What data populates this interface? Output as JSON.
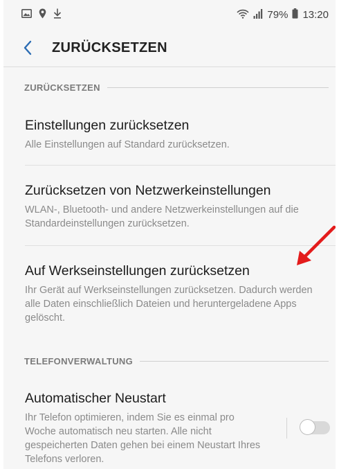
{
  "status_bar": {
    "battery_percent": "79%",
    "time": "13:20",
    "icons_left": [
      "image-icon",
      "location-icon",
      "download-icon"
    ],
    "icons_right": [
      "wifi-icon",
      "signal-icon",
      "battery-icon"
    ]
  },
  "header": {
    "back_icon": "chevron-left-icon",
    "title": "ZURÜCKSETZEN"
  },
  "sections": [
    {
      "title": "ZURÜCKSETZEN",
      "items": [
        {
          "title": "Einstellungen zurücksetzen",
          "subtitle": "Alle Einstellungen auf Standard zurücksetzen."
        },
        {
          "title": "Zurücksetzen von Netzwerkeinstellungen",
          "subtitle": "WLAN-, Bluetooth- und andere Netzwerkeinstellungen auf die Standardeinstellungen zurücksetzen."
        },
        {
          "title": "Auf Werkseinstellungen zurücksetzen",
          "subtitle": "Ihr Gerät auf Werkseinstellungen zurücksetzen. Dadurch werden alle Daten einschließlich Dateien und heruntergeladene Apps gelöscht."
        }
      ]
    },
    {
      "title": "TELEFONVERWALTUNG",
      "items": [
        {
          "title": "Automatischer Neustart",
          "subtitle": "Ihr Telefon optimieren, indem Sie es einmal pro Woche automatisch neu starten. Alle nicht gespeicherten Daten gehen bei einem Neustart Ihres Telefons verloren.",
          "toggle": false
        }
      ]
    }
  ],
  "colors": {
    "accent": "#2b6cb3",
    "annotation_arrow": "#e31b1b",
    "background": "#f6f6f6"
  }
}
